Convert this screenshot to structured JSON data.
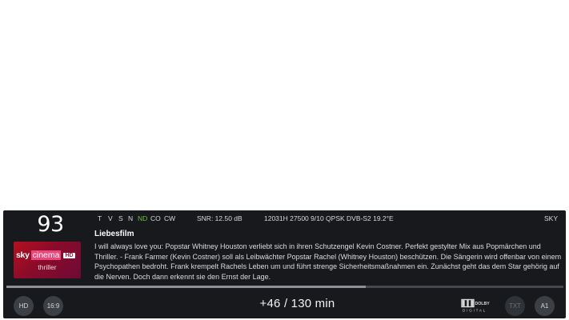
{
  "channel": {
    "number": "93",
    "logo": {
      "brand": "sky",
      "name": "cinema",
      "badge": "HD",
      "genre": "thriller",
      "colors": {
        "primary": "#c2112e",
        "accent": "#e8477b"
      }
    }
  },
  "status": {
    "flags": [
      {
        "label": "T",
        "active": false
      },
      {
        "label": "V",
        "active": false
      },
      {
        "label": "S",
        "active": false
      },
      {
        "label": "N",
        "active": false
      },
      {
        "label": "ND",
        "active": true
      },
      {
        "label": "CO",
        "active": false
      },
      {
        "label": "CW",
        "active": false
      }
    ],
    "snr": "SNR:  12.50 dB",
    "transponder": "12031H  27500  9/10  QPSK  DVB-S2  19.2°E",
    "provider": "SKY"
  },
  "program": {
    "title": "Liebesfilm",
    "description": "I will always love you: Popstar Whitney Houston verliebt sich in ihren Schutzengel Kevin Costner. Perfekt gestylter Mix aus Popmärchen und Thriller. - Frank Farmer (Kevin Costner) soll als Leibwächter Popstar Rachel (Whitney Houston) beschützen. Die Sängerin wird offenbar von einem Psychopathen bedroht. Frank krempelt Rachels Leben um und führt strenge Sicherheitsmaßnahmen ein. Zunächst geht das dem Star gehörig auf die Nerven. Doch dann erkennt sie den Ernst der Lage.",
    "progress": 0.645
  },
  "bottom": {
    "hd_label": "HD",
    "aspect_label": "16:9",
    "time": "+46  /  130 min",
    "dolby_top": "DOLBY",
    "dolby_bottom": "DIGITAL",
    "teletext_label": "TXT",
    "audio_label": "A1"
  },
  "colors": {
    "status_active": "#6fbf3b",
    "background": "#17191c"
  }
}
